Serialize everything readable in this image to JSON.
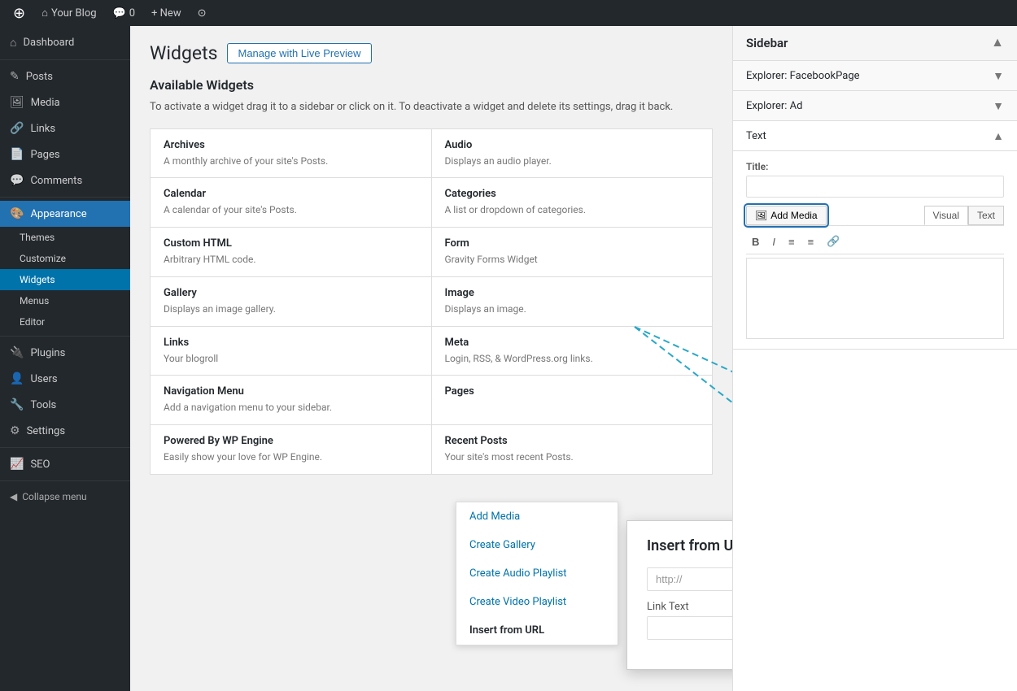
{
  "adminbar": {
    "logo": "⊕",
    "site_name": "Your Blog",
    "comments_label": "0",
    "new_label": "+ New",
    "customize_icon": "⊙"
  },
  "sidebar": {
    "items": [
      {
        "id": "dashboard",
        "label": "Dashboard",
        "icon": "⌂"
      },
      {
        "id": "posts",
        "label": "Posts",
        "icon": "📝"
      },
      {
        "id": "media",
        "label": "Media",
        "icon": "🖼"
      },
      {
        "id": "links",
        "label": "Links",
        "icon": "🔗"
      },
      {
        "id": "pages",
        "label": "Pages",
        "icon": "📄"
      },
      {
        "id": "comments",
        "label": "Comments",
        "icon": "💬"
      },
      {
        "id": "appearance",
        "label": "Appearance",
        "icon": "🎨",
        "active": true
      },
      {
        "id": "themes",
        "label": "Themes",
        "sub": true
      },
      {
        "id": "customize",
        "label": "Customize",
        "sub": true
      },
      {
        "id": "widgets",
        "label": "Widgets",
        "sub": true,
        "active": true
      },
      {
        "id": "menus",
        "label": "Menus",
        "sub": true
      },
      {
        "id": "editor",
        "label": "Editor",
        "sub": true
      },
      {
        "id": "plugins",
        "label": "Plugins",
        "icon": "🔌"
      },
      {
        "id": "users",
        "label": "Users",
        "icon": "👤"
      },
      {
        "id": "tools",
        "label": "Tools",
        "icon": "🔧"
      },
      {
        "id": "settings",
        "label": "Settings",
        "icon": "⚙"
      },
      {
        "id": "seo",
        "label": "SEO",
        "icon": "📈"
      }
    ],
    "collapse_label": "Collapse menu"
  },
  "page": {
    "title": "Widgets",
    "live_preview_label": "Manage with Live Preview"
  },
  "available_widgets": {
    "title": "Available Widgets",
    "description": "To activate a widget drag it to a sidebar or click on it. To deactivate a widget and delete its settings, drag it back.",
    "widgets": [
      {
        "name": "Archives",
        "desc": "A monthly archive of your site's Posts."
      },
      {
        "name": "Audio",
        "desc": "Displays an audio player."
      },
      {
        "name": "Calendar",
        "desc": "A calendar of your site's Posts."
      },
      {
        "name": "Categories",
        "desc": "A list or dropdown of categories."
      },
      {
        "name": "Custom HTML",
        "desc": "Arbitrary HTML code."
      },
      {
        "name": "Form",
        "desc": "Gravity Forms Widget"
      },
      {
        "name": "Gallery",
        "desc": "Displays an image gallery."
      },
      {
        "name": "Image",
        "desc": "Displays an image."
      },
      {
        "name": "Links",
        "desc": "Your blogroll"
      },
      {
        "name": "Meta",
        "desc": "Login, RSS, & WordPress.org links."
      },
      {
        "name": "Navigation Menu",
        "desc": "Add a navigation menu to your sidebar."
      },
      {
        "name": "Pages",
        "desc": ""
      },
      {
        "name": "Powered By WP Engine",
        "desc": "Easily show your love for WP Engine."
      },
      {
        "name": "Recent Posts",
        "desc": "Your site's most recent Posts."
      }
    ]
  },
  "sidebar_panel": {
    "title": "Sidebar",
    "collapse_icon": "▲",
    "widgets": [
      {
        "name": "Explorer: FacebookPage",
        "expanded": false,
        "toggle_icon": "▼"
      },
      {
        "name": "Explorer: Ad",
        "expanded": false,
        "toggle_icon": "▼"
      },
      {
        "name": "Text",
        "expanded": true,
        "toggle_icon": "▲",
        "title_label": "Title:",
        "title_value": "",
        "add_media_label": "Add Media",
        "add_media_icon": "🖼",
        "visual_tab": "Visual",
        "text_tab": "Text",
        "format_buttons": [
          "B",
          "I",
          "≡",
          "≡",
          "🔗"
        ],
        "editor_content": ""
      }
    ]
  },
  "add_media_dropdown": {
    "items": [
      {
        "id": "add-media",
        "label": "Add Media"
      },
      {
        "id": "create-gallery",
        "label": "Create Gallery"
      },
      {
        "id": "create-audio-playlist",
        "label": "Create Audio Playlist"
      },
      {
        "id": "create-video-playlist",
        "label": "Create Video Playlist"
      },
      {
        "id": "insert-from-url",
        "label": "Insert from URL"
      }
    ]
  },
  "insert_url_dialog": {
    "title": "Insert from URL",
    "close_icon": "×",
    "url_label": "",
    "url_placeholder": "http://",
    "link_text_label": "Link Text",
    "link_text_value": ""
  }
}
